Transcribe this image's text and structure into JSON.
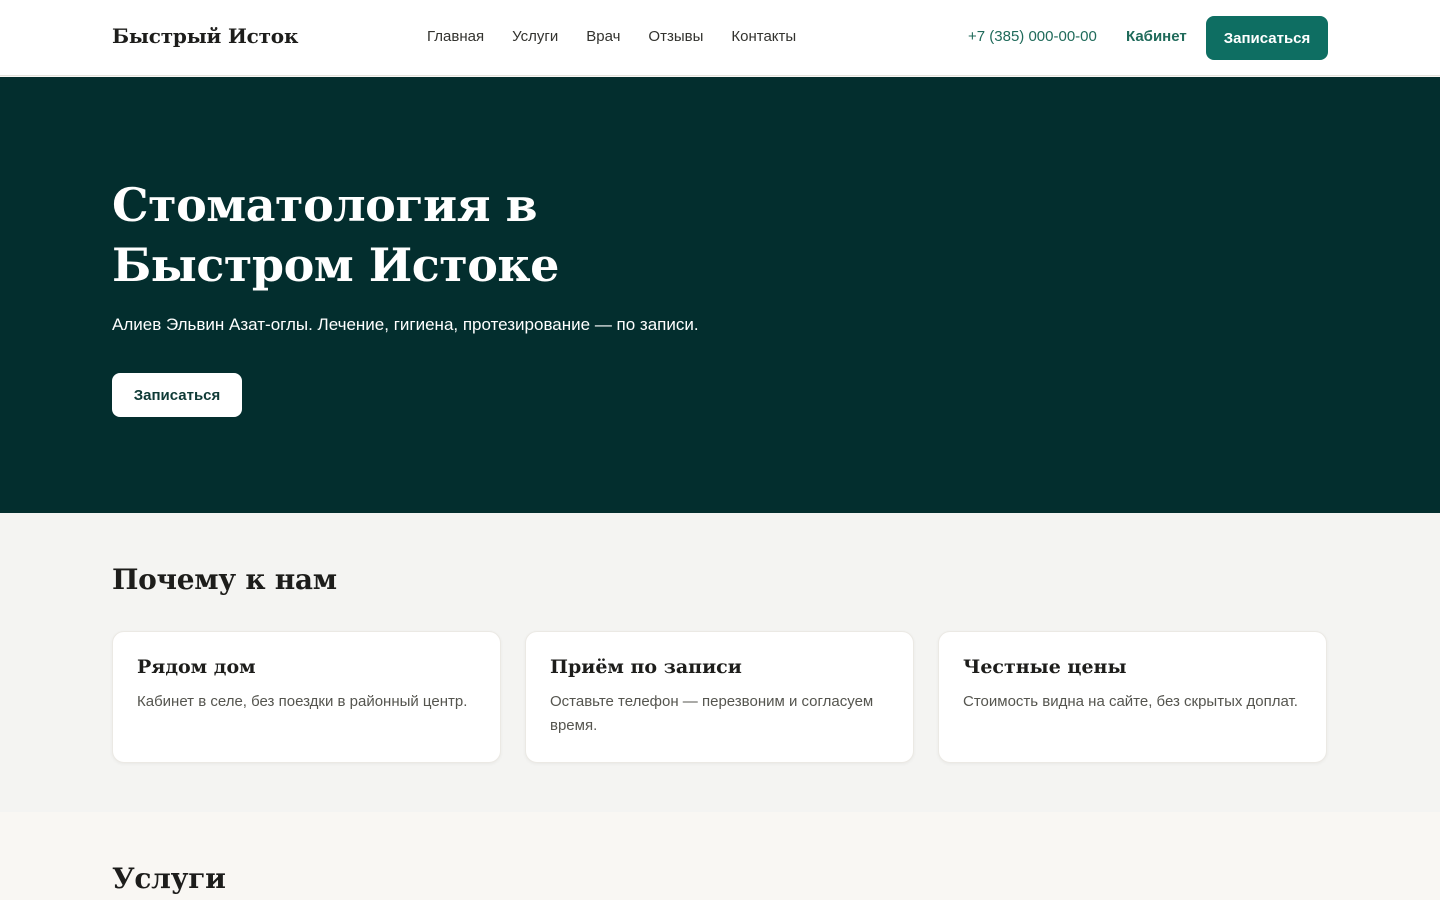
{
  "header": {
    "brand": "Быстрый Исток",
    "nav": [
      "Главная",
      "Услуги",
      "Врач",
      "Отзывы",
      "Контакты"
    ],
    "phone": "+7 (385) 000-00-00",
    "cabinet": "Кабинет",
    "cta": "Записаться"
  },
  "hero": {
    "title": "Стоматология в Быстром Истоке",
    "subtitle": "Алиев Эльвин Азат-оглы. Лечение, гигиена, протезирование — по записи.",
    "cta": "Записаться"
  },
  "why": {
    "title": "Почему к нам",
    "cards": [
      {
        "title": "Рядом дом",
        "text": "Кабинет в селе, без поездки в районный центр."
      },
      {
        "title": "Приём по записи",
        "text": "Оставьте телефон — перезвоним и согласуем время."
      },
      {
        "title": "Честные цены",
        "text": "Стоимость видна на сайте, без скрытых доплат."
      }
    ]
  },
  "services": {
    "title": "Услуги"
  },
  "colors": {
    "hero_bg": "#032e2e",
    "accent": "#0e6e62",
    "link": "#1f6a5a",
    "section_bg": "#f4f4f2"
  }
}
